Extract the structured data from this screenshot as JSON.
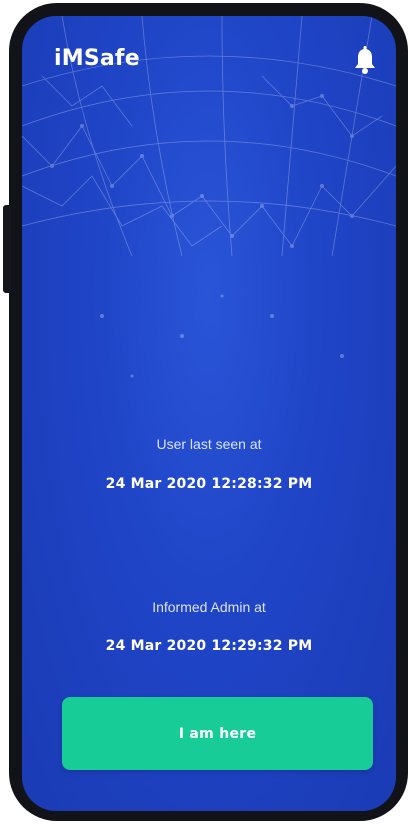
{
  "app": {
    "title": "iMSafe",
    "notification_icon": "bell-icon"
  },
  "status": {
    "last_seen_label": "User last seen at",
    "last_seen_value": "24 Mar 2020 12:28:32 PM",
    "informed_admin_label": "Informed Admin at",
    "informed_admin_value": "24 Mar 2020 12:29:32 PM"
  },
  "actions": {
    "primary_label": "I am here"
  },
  "colors": {
    "background": "#1f44c6",
    "accent": "#18cc98",
    "text": "#ffffff"
  }
}
